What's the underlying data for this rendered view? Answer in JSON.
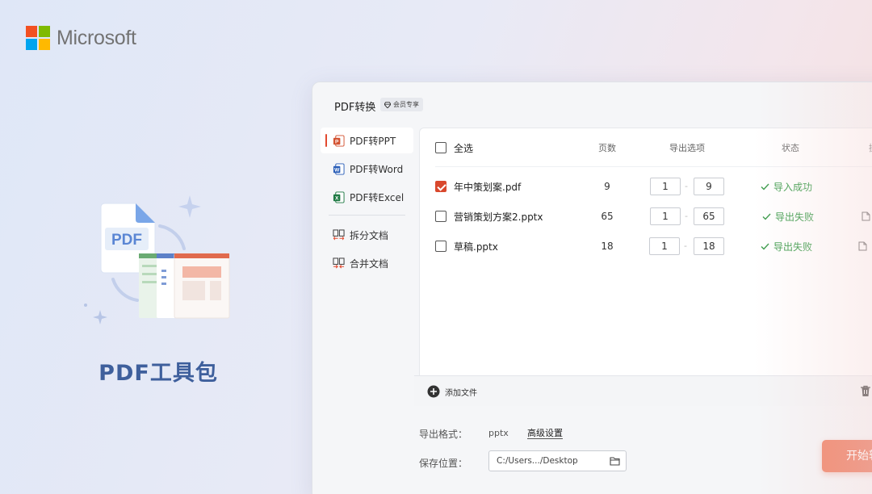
{
  "brand": {
    "name": "Microsoft"
  },
  "hero": {
    "title": "PDF工具包",
    "icon_label": "PDF"
  },
  "window": {
    "title": "PDF转换",
    "badge": "会员专享",
    "sidebar": {
      "items": [
        {
          "label": "PDF转PPT",
          "icon": "ppt-icon",
          "active": true
        },
        {
          "label": "PDF转Word",
          "icon": "word-icon",
          "active": false
        },
        {
          "label": "PDF转Excel",
          "icon": "excel-icon",
          "active": false
        },
        {
          "label": "拆分文档",
          "icon": "split-icon",
          "active": false
        },
        {
          "label": "合并文档",
          "icon": "merge-icon",
          "active": false
        }
      ]
    },
    "table": {
      "headers": {
        "select_all": "全选",
        "pages": "页数",
        "export": "导出选项",
        "status": "状态",
        "op": "操"
      },
      "rows": [
        {
          "name": "年中策划案.pdf",
          "pages": "9",
          "from": "1",
          "to": "9",
          "status": "导入成功",
          "checked": true
        },
        {
          "name": "营销策划方案2.pptx",
          "pages": "65",
          "from": "1",
          "to": "65",
          "status": "导出失败",
          "checked": false
        },
        {
          "name": "草稿.pptx",
          "pages": "18",
          "from": "1",
          "to": "18",
          "status": "导出失败",
          "checked": false
        }
      ],
      "range_separator": "-"
    },
    "footer": {
      "add_file": "添加文件"
    },
    "settings": {
      "format_label": "导出格式：",
      "format_value": "pptx",
      "advanced": "高级设置",
      "save_label": "保存位置：",
      "save_path": "C:/Users.../Desktop"
    },
    "start_button": "开始转换"
  },
  "colors": {
    "accent": "#e2492e",
    "success": "#3a9b4a",
    "title": "#3e5f9c"
  }
}
